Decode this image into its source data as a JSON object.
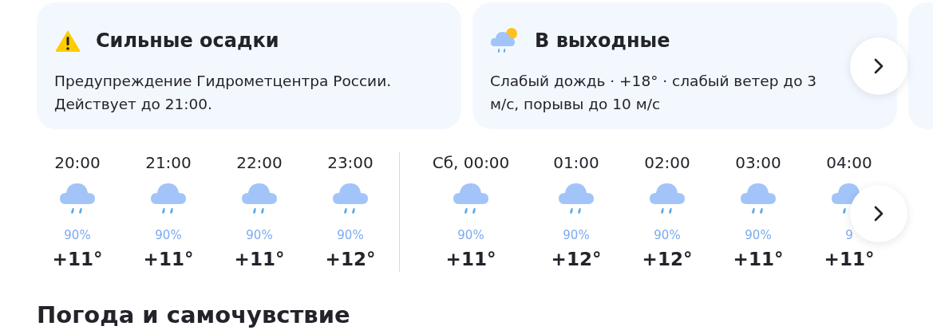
{
  "cards": [
    {
      "kind": "warning",
      "title": "Сильные осадки",
      "text": "Предупреждение Гидрометцентра России. Действует до 21:00."
    },
    {
      "kind": "rain_sun",
      "title": "В выходные",
      "text": "Слабый дождь · +18° · слабый ветер до 3 м/с, порывы до 10 м/с"
    }
  ],
  "hourly": {
    "groups": [
      {
        "hours": [
          {
            "time": "20:00",
            "kind": "rain",
            "precip": "90%",
            "temp": "+11°"
          },
          {
            "time": "21:00",
            "kind": "rain",
            "precip": "90%",
            "temp": "+11°"
          },
          {
            "time": "22:00",
            "kind": "rain",
            "precip": "90%",
            "temp": "+11°"
          },
          {
            "time": "23:00",
            "kind": "rain",
            "precip": "90%",
            "temp": "+12°"
          }
        ]
      },
      {
        "hours": [
          {
            "time": "Сб, 00:00",
            "kind": "rain",
            "precip": "90%",
            "temp": "+11°"
          },
          {
            "time": "01:00",
            "kind": "rain",
            "precip": "90%",
            "temp": "+12°"
          },
          {
            "time": "02:00",
            "kind": "rain",
            "precip": "90%",
            "temp": "+12°"
          },
          {
            "time": "03:00",
            "kind": "rain",
            "precip": "90%",
            "temp": "+11°"
          },
          {
            "time": "04:00",
            "kind": "rain",
            "precip": "9",
            "temp": "+11°"
          }
        ]
      }
    ]
  },
  "section_title": "Погода и самочувствие"
}
